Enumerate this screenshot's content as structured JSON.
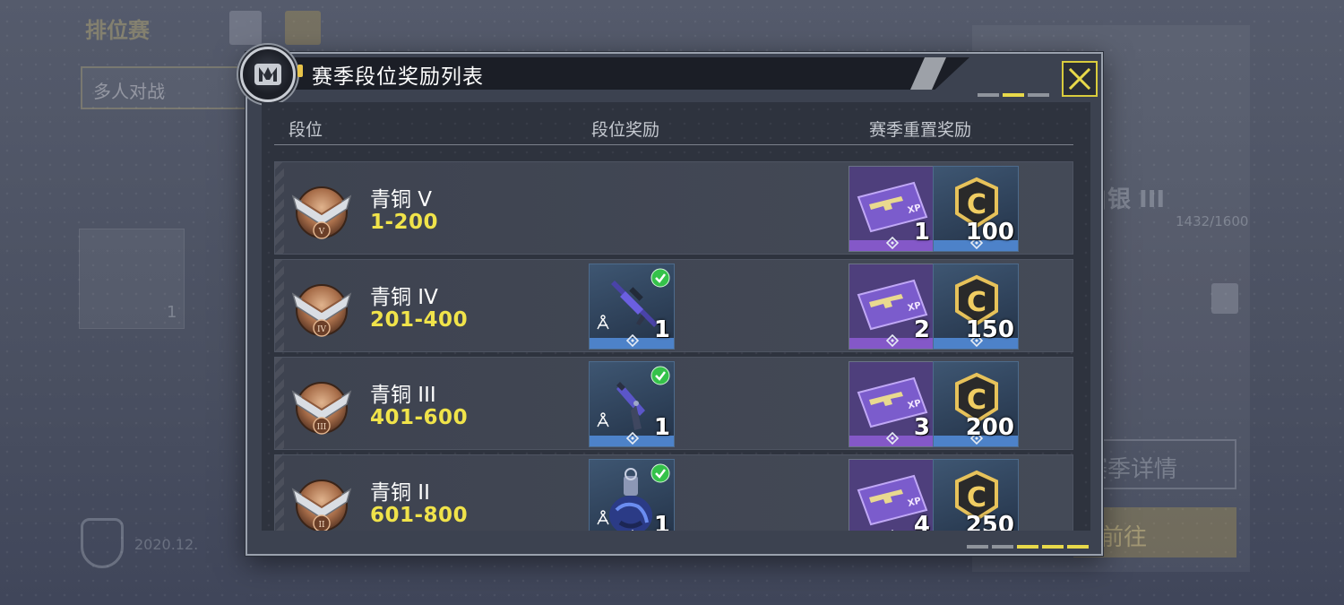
{
  "background": {
    "title": "排位赛",
    "mode_label": "多人对战",
    "card_count": "1",
    "season_date": "2020.12.",
    "rank_label": "白银 III",
    "rank_progress": "1432/1600",
    "detail_label": "赛季详情",
    "go_label": "前往"
  },
  "modal": {
    "title": "赛季段位奖励列表",
    "columns": {
      "rank": "段位",
      "rank_reward": "段位奖励",
      "reset_reward": "赛季重置奖励"
    },
    "rows": [
      {
        "rank": "青铜 V",
        "range": "1-200",
        "badge_numeral": "V",
        "rank_reward": null,
        "xp_card_qty": "1",
        "cp_qty": "100"
      },
      {
        "rank": "青铜 IV",
        "range": "201-400",
        "badge_numeral": "IV",
        "rank_reward": {
          "item": "sniper-rifle-skin",
          "qty": "1",
          "claimed": true
        },
        "xp_card_qty": "2",
        "cp_qty": "150"
      },
      {
        "rank": "青铜 III",
        "range": "401-600",
        "badge_numeral": "III",
        "rank_reward": {
          "item": "pistol-skin",
          "qty": "1",
          "claimed": true
        },
        "xp_card_qty": "3",
        "cp_qty": "200"
      },
      {
        "rank": "青铜 II",
        "range": "601-800",
        "badge_numeral": "II",
        "rank_reward": {
          "item": "grenade-skin",
          "qty": "1",
          "claimed": true
        },
        "xp_card_qty": "4",
        "cp_qty": "250"
      }
    ]
  },
  "colors": {
    "accent_yellow": "#f0e34a",
    "close_border": "#d9cc3d",
    "claimed_green": "#35c24a",
    "rarity_purple": "#8458c8",
    "rarity_blue": "#4d82c9"
  },
  "icons": {
    "close": "close-x-icon",
    "claimed": "checkmark-icon",
    "xp_card": "weapon-xp-card-icon",
    "currency": "cod-points-icon",
    "tool": "compass-blueprint-icon"
  }
}
